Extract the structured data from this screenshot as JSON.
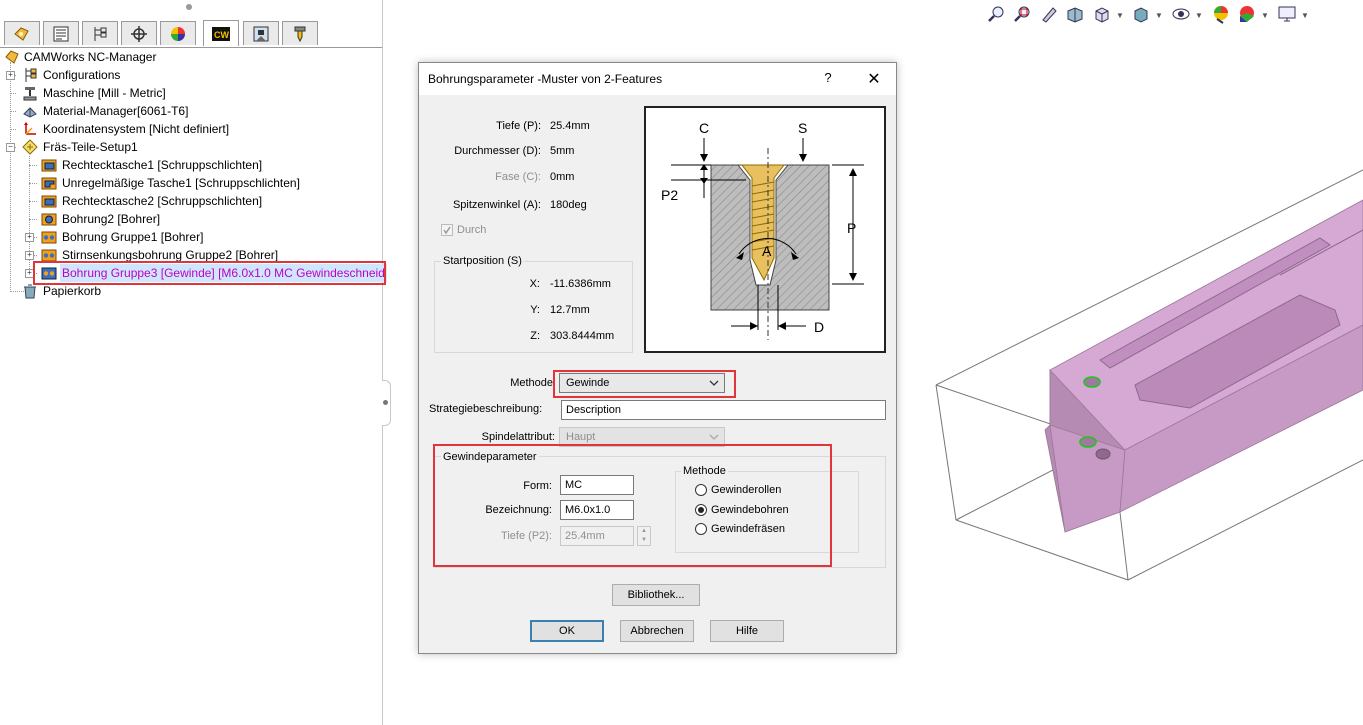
{
  "left_panel": {
    "tabs": [
      {
        "icon": "feature-manager-icon"
      },
      {
        "icon": "property-manager-icon"
      },
      {
        "icon": "configuration-manager-icon"
      },
      {
        "icon": "dimxpert-icon"
      },
      {
        "icon": "display-manager-icon"
      },
      {
        "icon": "camworks-feature-tree-icon",
        "label": "CW"
      },
      {
        "icon": "camworks-operation-tree-icon"
      },
      {
        "icon": "camworks-tool-tree-icon"
      }
    ],
    "tree": {
      "root": "CAMWorks NC-Manager",
      "items": [
        {
          "label": "Configurations"
        },
        {
          "label": "Maschine [Mill - Metric]"
        },
        {
          "label": "Material-Manager[6061-T6]"
        },
        {
          "label": "Koordinatensystem [Nicht definiert]"
        },
        {
          "label": "Fräs-Teile-Setup1"
        },
        {
          "label": "Rechtecktasche1 [Schruppschlichten]"
        },
        {
          "label": "Unregelmäßige Tasche1 [Schruppschlichten]"
        },
        {
          "label": "Rechtecktasche2 [Schruppschlichten]"
        },
        {
          "label": "Bohrung2 [Bohrer]"
        },
        {
          "label": "Bohrung Gruppe1 [Bohrer]"
        },
        {
          "label": "Stirnsenkungsbohrung Gruppe2 [Bohrer]"
        },
        {
          "label": "Bohrung Gruppe3 [Gewinde] [M6.0x1.0 MC Gewindeschneid"
        },
        {
          "label": "Papierkorb"
        }
      ]
    }
  },
  "dialog": {
    "title": "Bohrungsparameter -Muster von 2-Features",
    "help": "?",
    "close": "✕",
    "params": {
      "depth_label": "Tiefe (P):",
      "depth_value": "25.4mm",
      "diameter_label": "Durchmesser (D):",
      "diameter_value": "5mm",
      "chamfer_label": "Fase (C):",
      "chamfer_value": "0mm",
      "tip_angle_label": "Spitzenwinkel (A):",
      "tip_angle_value": "180deg",
      "through_label": "Durch"
    },
    "start_position": {
      "title": "Startposition (S)",
      "x_label": "X:",
      "x_value": "-11.6386mm",
      "y_label": "Y:",
      "y_value": "12.7mm",
      "z_label": "Z:",
      "z_value": "303.8444mm"
    },
    "diagram_labels": {
      "c": "C",
      "s": "S",
      "p2": "P2",
      "p": "P",
      "a": "A",
      "d": "D"
    },
    "method_label": "Methode",
    "method_value": "Gewinde",
    "strategy_label": "Strategiebeschreibung:",
    "strategy_value": "Description",
    "spindle_label": "Spindelattribut:",
    "spindle_value": "Haupt",
    "thread": {
      "title": "Gewindeparameter",
      "form_label": "Form:",
      "form_value": "MC",
      "designation_label": "Bezeichnung:",
      "designation_value": "M6.0x1.0",
      "depth_label": "Tiefe (P2):",
      "depth_value": "25.4mm",
      "method_title": "Methode",
      "methods": [
        {
          "label": "Gewinderollen",
          "selected": false
        },
        {
          "label": "Gewindebohren",
          "selected": true
        },
        {
          "label": "Gewindefräsen",
          "selected": false
        }
      ]
    },
    "buttons": {
      "library": "Bibliothek...",
      "ok": "OK",
      "cancel": "Abbrechen",
      "help": "Hilfe"
    }
  },
  "view_toolbar": {
    "icons": [
      "zoom-to-fit-icon",
      "zoom-to-area-icon",
      "previous-view-icon",
      "section-view-icon",
      "view-orientation-icon",
      "display-style-icon",
      "hide-show-items-icon",
      "edit-appearance-icon",
      "apply-scene-icon",
      "view-settings-icon"
    ]
  },
  "colors": {
    "part": "#d6a8d4",
    "highlight": "#e0353b",
    "selected_text": "#c000c0",
    "default_button": "#3c7fb1"
  }
}
